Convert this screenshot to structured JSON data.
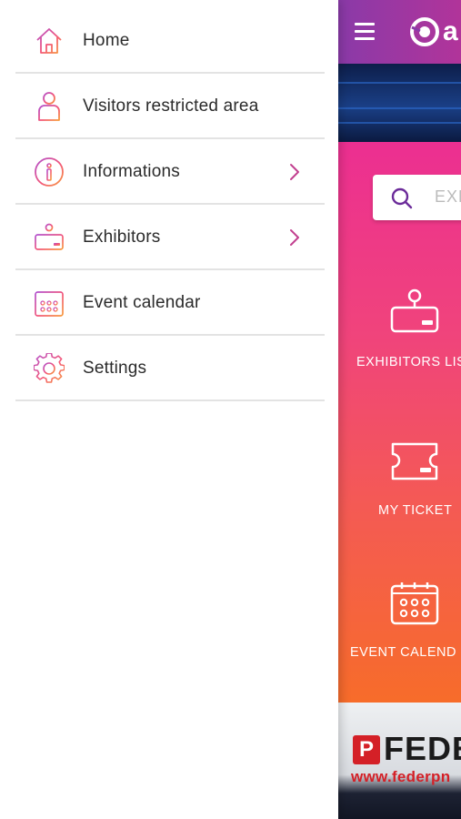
{
  "drawer": {
    "items": [
      {
        "label": "Home",
        "icon": "home-icon",
        "has_submenu": false
      },
      {
        "label": "Visitors restricted area",
        "icon": "user-icon",
        "has_submenu": false
      },
      {
        "label": "Informations",
        "icon": "info-icon",
        "has_submenu": true
      },
      {
        "label": "Exhibitors",
        "icon": "booth-icon",
        "has_submenu": true
      },
      {
        "label": "Event calendar",
        "icon": "calendar-icon",
        "has_submenu": false
      },
      {
        "label": "Settings",
        "icon": "gear-icon",
        "has_submenu": false
      }
    ]
  },
  "app": {
    "logo_letter": "a",
    "search_placeholder": "EXH",
    "tiles": [
      {
        "label": "EXHIBITORS LIS",
        "icon": "booth-icon"
      },
      {
        "label": "MY TICKET",
        "icon": "ticket-icon"
      },
      {
        "label": "EVENT CALEND",
        "icon": "calendar-icon"
      }
    ],
    "banner": {
      "brand_letter": "P",
      "brand_text": "FEDE",
      "url": "www.federpn"
    }
  },
  "colors": {
    "header_gradient": [
      "#8a3aa8",
      "#b1349a"
    ],
    "main_gradient": [
      "#ec2f91",
      "#f76c2a"
    ],
    "icon_gradient": [
      "#b04fd0",
      "#f3567a",
      "#f79a3a"
    ],
    "chevron": "#c2408f"
  }
}
